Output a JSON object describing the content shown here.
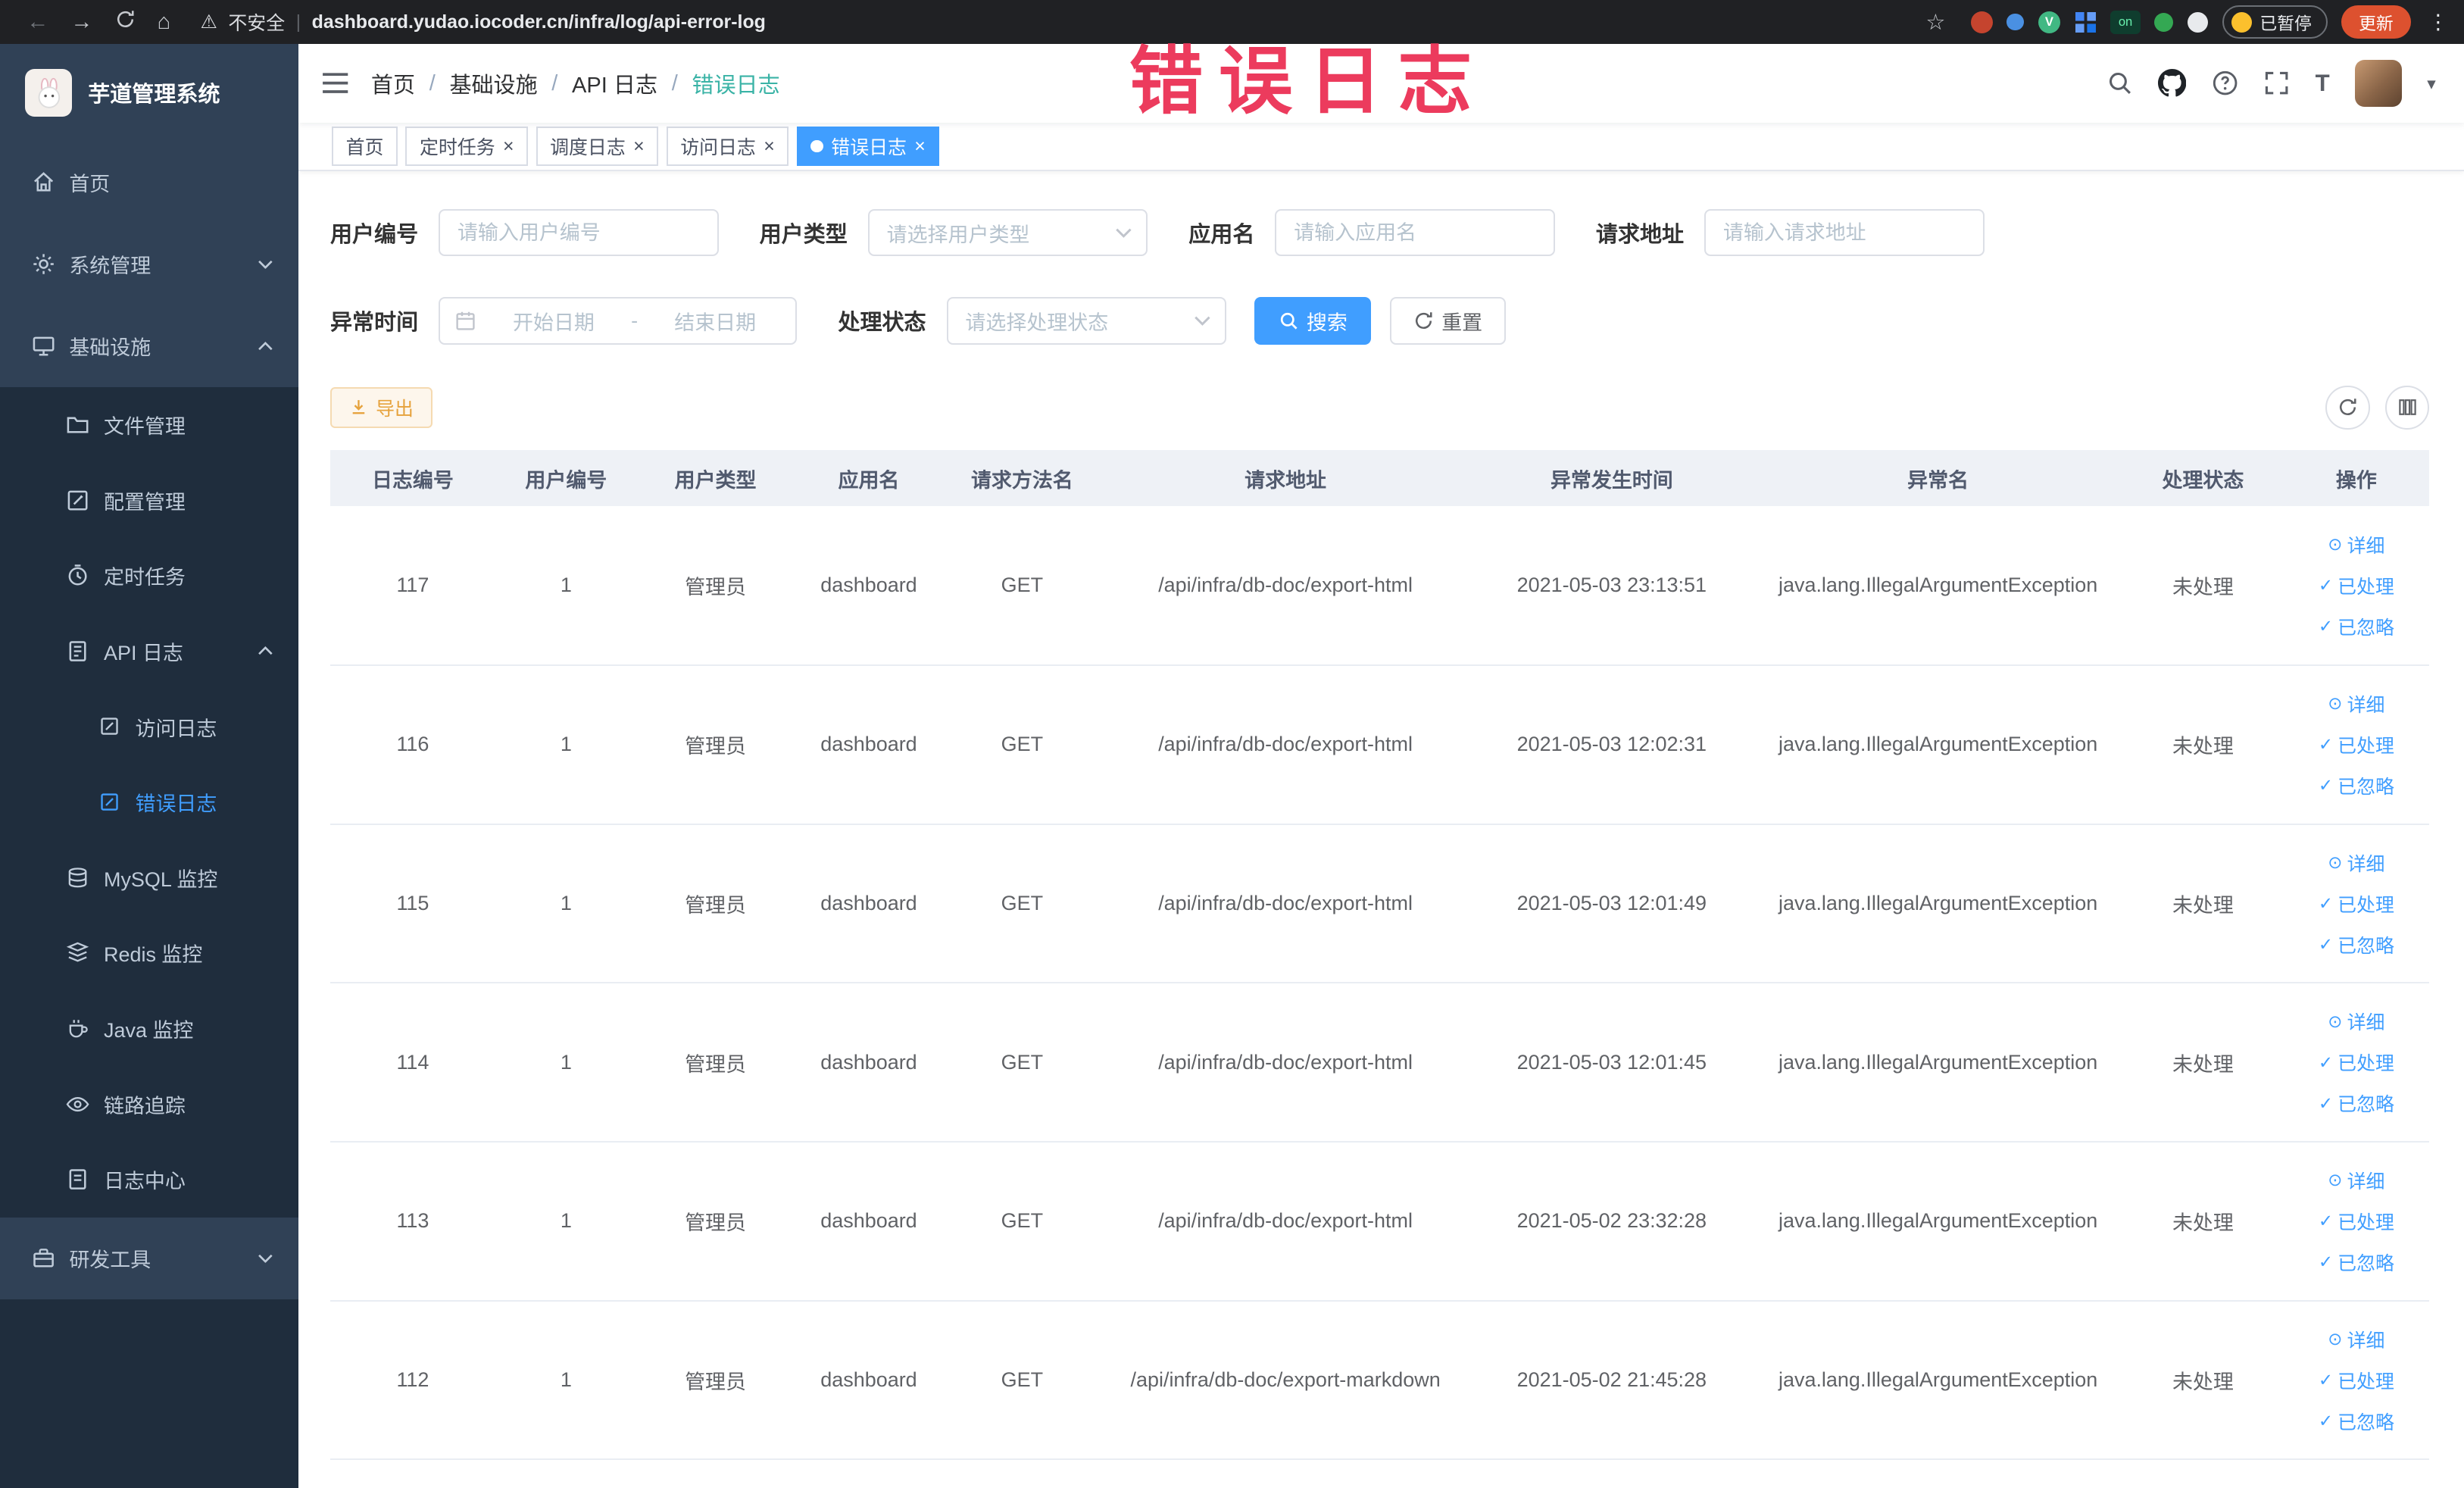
{
  "browser": {
    "security_label": "不安全",
    "url": "dashboard.yudao.iocoder.cn/infra/log/api-error-log",
    "paused_button": "已暂停",
    "update_button": "更新"
  },
  "icons": {
    "back": "←",
    "forward": "→",
    "home": "⌂",
    "warning": "⚠",
    "star": "☆",
    "menu_dots": "⋮",
    "divider": "|",
    "caret_down": "▾",
    "close": "×",
    "letter_v": "V",
    "on_badge": "on",
    "text_size": "T"
  },
  "annotation": {
    "text": "错误日志",
    "color": "#ec3b5d"
  },
  "sidebar": {
    "logo_title": "芋道管理系统",
    "items": [
      {
        "label": "首页"
      },
      {
        "label": "系统管理"
      },
      {
        "label": "基础设施"
      },
      {
        "label": "文件管理"
      },
      {
        "label": "配置管理"
      },
      {
        "label": "定时任务"
      },
      {
        "label": "API 日志"
      },
      {
        "label": "访问日志"
      },
      {
        "label": "错误日志"
      },
      {
        "label": "MySQL 监控"
      },
      {
        "label": "Redis 监控"
      },
      {
        "label": "Java 监控"
      },
      {
        "label": "链路追踪"
      },
      {
        "label": "日志中心"
      },
      {
        "label": "研发工具"
      }
    ]
  },
  "header": {
    "breadcrumb": {
      "separator": "/",
      "items": [
        "首页",
        "基础设施",
        "API 日志",
        "错误日志"
      ]
    }
  },
  "tabs": [
    {
      "label": "首页"
    },
    {
      "label": "定时任务"
    },
    {
      "label": "调度日志"
    },
    {
      "label": "访问日志"
    },
    {
      "label": "错误日志"
    }
  ],
  "filters": {
    "user_id": {
      "label": "用户编号",
      "placeholder": "请输入用户编号"
    },
    "user_type": {
      "label": "用户类型",
      "placeholder": "请选择用户类型"
    },
    "app_name": {
      "label": "应用名",
      "placeholder": "请输入应用名"
    },
    "request_url": {
      "label": "请求地址",
      "placeholder": "请输入请求地址"
    },
    "exception_time": {
      "label": "异常时间",
      "start_placeholder": "开始日期",
      "separator": "-",
      "end_placeholder": "结束日期"
    },
    "process_status": {
      "label": "处理状态",
      "placeholder": "请选择处理状态"
    },
    "search_button": "搜索",
    "reset_button": "重置"
  },
  "toolbar": {
    "export_button": "导出"
  },
  "table": {
    "columns": [
      "日志编号",
      "用户编号",
      "用户类型",
      "应用名",
      "请求方法名",
      "请求地址",
      "异常发生时间",
      "异常名",
      "处理状态",
      "操作"
    ],
    "row_actions": [
      {
        "name": "detail",
        "icon": "⊙",
        "label": "详细"
      },
      {
        "name": "processed",
        "icon": "✓",
        "label": "已处理"
      },
      {
        "name": "ignored",
        "icon": "✓",
        "label": "已忽略"
      }
    ],
    "rows": [
      {
        "cells": [
          "117",
          "1",
          "管理员",
          "dashboard",
          "GET",
          "/api/infra/db-doc/export-html",
          "2021-05-03 23:13:51",
          "java.lang.IllegalArgumentException",
          "未处理"
        ]
      },
      {
        "cells": [
          "116",
          "1",
          "管理员",
          "dashboard",
          "GET",
          "/api/infra/db-doc/export-html",
          "2021-05-03 12:02:31",
          "java.lang.IllegalArgumentException",
          "未处理"
        ]
      },
      {
        "cells": [
          "115",
          "1",
          "管理员",
          "dashboard",
          "GET",
          "/api/infra/db-doc/export-html",
          "2021-05-03 12:01:49",
          "java.lang.IllegalArgumentException",
          "未处理"
        ]
      },
      {
        "cells": [
          "114",
          "1",
          "管理员",
          "dashboard",
          "GET",
          "/api/infra/db-doc/export-html",
          "2021-05-03 12:01:45",
          "java.lang.IllegalArgumentException",
          "未处理"
        ]
      },
      {
        "cells": [
          "113",
          "1",
          "管理员",
          "dashboard",
          "GET",
          "/api/infra/db-doc/export-html",
          "2021-05-02 23:32:28",
          "java.lang.IllegalArgumentException",
          "未处理"
        ]
      },
      {
        "cells": [
          "112",
          "1",
          "管理员",
          "dashboard",
          "GET",
          "/api/infra/db-doc/export-markdown",
          "2021-05-02 21:45:28",
          "java.lang.IllegalArgumentException",
          "未处理"
        ]
      }
    ]
  }
}
